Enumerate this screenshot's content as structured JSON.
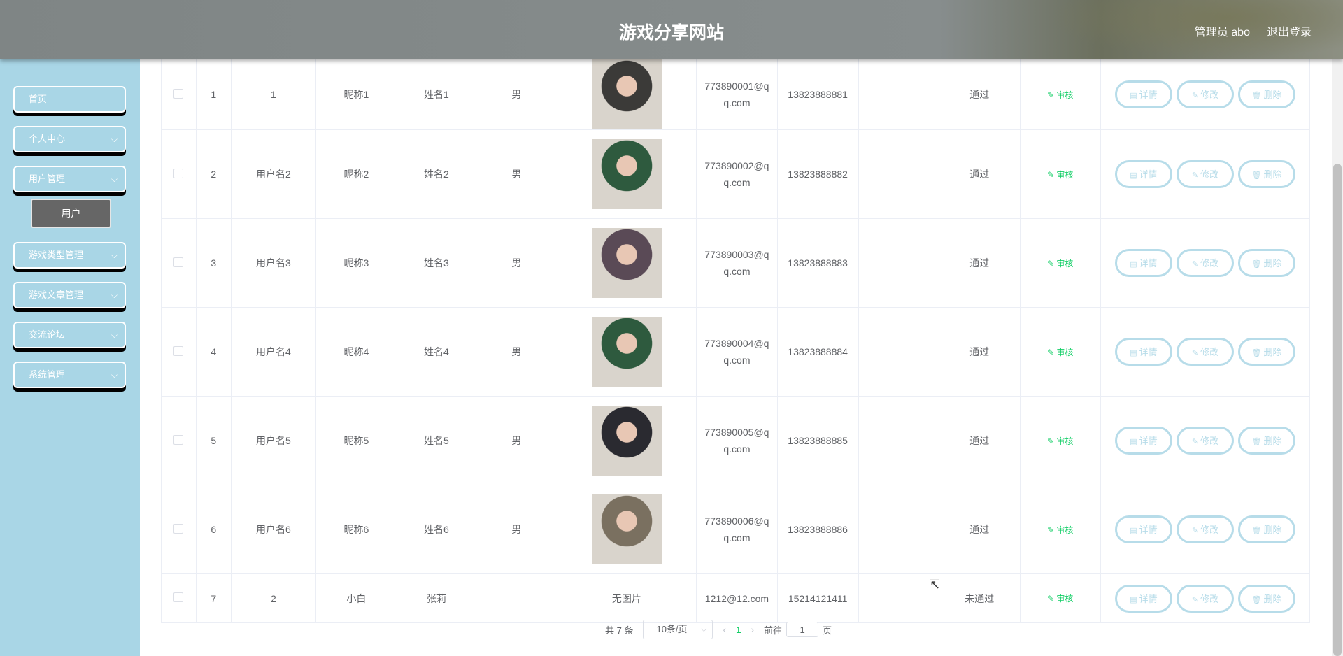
{
  "header": {
    "title": "游戏分享网站",
    "user_label": "管理员 abo",
    "logout_label": "退出登录"
  },
  "sidebar": {
    "items": [
      {
        "label": "首页",
        "has_children": false
      },
      {
        "label": "个人中心",
        "has_children": true
      },
      {
        "label": "用户管理",
        "has_children": true
      },
      {
        "label": "游戏类型管理",
        "has_children": true
      },
      {
        "label": "游戏文章管理",
        "has_children": true
      },
      {
        "label": "交流论坛",
        "has_children": true
      },
      {
        "label": "系统管理",
        "has_children": true
      }
    ],
    "sub_item": "用户"
  },
  "table": {
    "rows": [
      {
        "index": "1",
        "username": "1",
        "nickname": "昵称1",
        "name": "姓名1",
        "gender": "男",
        "photo": "photo",
        "email": "773890001@qq.com",
        "phone": "13823888881",
        "extra": "",
        "status": "通过",
        "audit": "审核"
      },
      {
        "index": "2",
        "username": "用户名2",
        "nickname": "昵称2",
        "name": "姓名2",
        "gender": "男",
        "photo": "photo",
        "email": "773890002@qq.com",
        "phone": "13823888882",
        "extra": "",
        "status": "通过",
        "audit": "审核"
      },
      {
        "index": "3",
        "username": "用户名3",
        "nickname": "昵称3",
        "name": "姓名3",
        "gender": "男",
        "photo": "photo",
        "email": "773890003@qq.com",
        "phone": "13823888883",
        "extra": "",
        "status": "通过",
        "audit": "审核"
      },
      {
        "index": "4",
        "username": "用户名4",
        "nickname": "昵称4",
        "name": "姓名4",
        "gender": "男",
        "photo": "photo",
        "email": "773890004@qq.com",
        "phone": "13823888884",
        "extra": "",
        "status": "通过",
        "audit": "审核"
      },
      {
        "index": "5",
        "username": "用户名5",
        "nickname": "昵称5",
        "name": "姓名5",
        "gender": "男",
        "photo": "photo",
        "email": "773890005@qq.com",
        "phone": "13823888885",
        "extra": "",
        "status": "通过",
        "audit": "审核"
      },
      {
        "index": "6",
        "username": "用户名6",
        "nickname": "昵称6",
        "name": "姓名6",
        "gender": "男",
        "photo": "photo",
        "email": "773890006@qq.com",
        "phone": "13823888886",
        "extra": "",
        "status": "通过",
        "audit": "审核"
      },
      {
        "index": "7",
        "username": "2",
        "nickname": "小白",
        "name": "张莉",
        "gender": "",
        "photo": "无图片",
        "email": "1212@12.com",
        "phone": "15214121411",
        "extra": "",
        "status": "未通过",
        "audit": "审核"
      }
    ],
    "actions": {
      "detail": "详情",
      "edit": "修改",
      "delete": "删除"
    },
    "avatar_colors": [
      "#3b3a38",
      "#2e5a3e",
      "#5a4a56",
      "#2e5a3e",
      "#2a2a30",
      "#7a7060"
    ]
  },
  "pagination": {
    "total_label": "共 7 条",
    "page_size": "10条/页",
    "current_page": "1",
    "goto_prefix": "前往",
    "goto_value": "1",
    "goto_suffix": "页"
  }
}
